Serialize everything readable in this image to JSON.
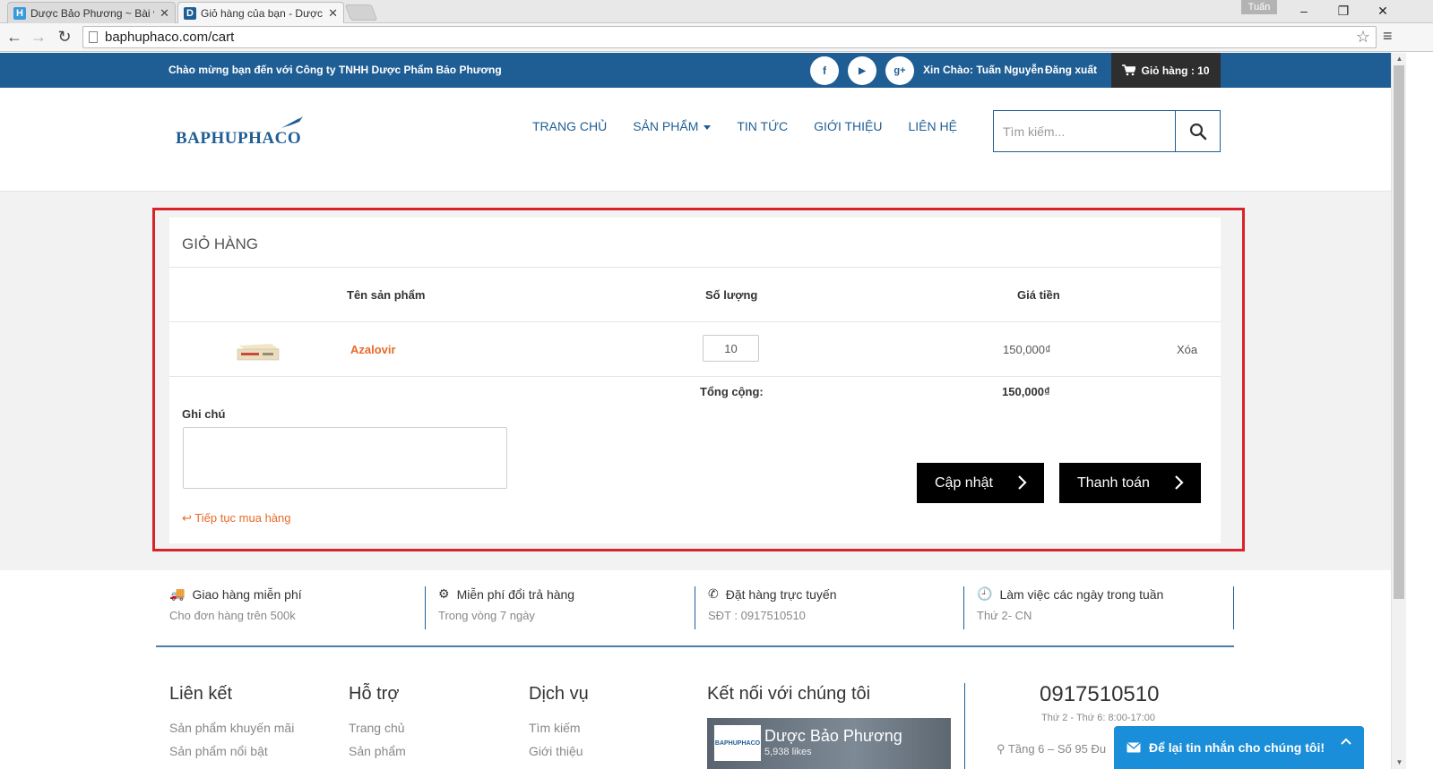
{
  "browser": {
    "tabs": [
      {
        "favicon": "H",
        "favicon_color": "#3a9ad9",
        "title": "Dược Bảo Phương ~ Bài vi",
        "active": false
      },
      {
        "favicon": "D",
        "favicon_color": "#1f5e94",
        "title": "Giỏ hàng của bạn - Dược",
        "active": true
      }
    ],
    "user_badge": "Tuấn",
    "url": "baphuphaco.com/cart"
  },
  "topbar": {
    "welcome": "Chào mừng bạn đến với Công ty TNHH Dược Phẩm Bảo Phương",
    "social": [
      "f",
      "▶",
      "g+"
    ],
    "greeting": "Xin Chào: Tuấn Nguyễn",
    "logout": "Đăng xuất",
    "cart_label": "Giỏ hàng : 10"
  },
  "header": {
    "logo_text": "BAPHUPHACO",
    "nav": [
      "TRANG CHỦ",
      "SẢN PHẨM",
      "TIN TỨC",
      "GIỚI THIỆU",
      "LIÊN HỆ"
    ],
    "search_placeholder": "Tìm kiếm..."
  },
  "cart": {
    "title": "GIỎ HÀNG",
    "columns": {
      "name": "Tên sản phẩm",
      "qty": "Số lượng",
      "price": "Giá tiền"
    },
    "items": [
      {
        "name": "Azalovir",
        "qty": "10",
        "price": "150,000₫",
        "delete": "Xóa"
      }
    ],
    "total_label": "Tổng cộng:",
    "total_value": "150,000₫",
    "note_label": "Ghi chú",
    "continue_link": "Tiếp tục mua hàng",
    "update_button": "Cập nhật",
    "checkout_button": "Thanh toán"
  },
  "features": [
    {
      "icon": "truck-icon",
      "title": "Giao hàng miễn phí",
      "subtitle": "Cho đơn hàng trên 500k"
    },
    {
      "icon": "gear-icon",
      "title": "Miễn phí đổi trả hàng",
      "subtitle": "Trong vòng 7 ngày"
    },
    {
      "icon": "phone-icon",
      "title": "Đặt hàng trực tuyến",
      "subtitle": "SĐT : 0917510510"
    },
    {
      "icon": "clock-icon",
      "title": "Làm việc các ngày trong tuần",
      "subtitle": "Thứ 2- CN"
    }
  ],
  "footer": {
    "col1": {
      "title": "Liên kết",
      "links": [
        "Sản phẩm khuyến mãi",
        "Sản phẩm nổi bật"
      ]
    },
    "col2": {
      "title": "Hỗ trợ",
      "links": [
        "Trang chủ",
        "Sản phẩm"
      ]
    },
    "col3": {
      "title": "Dịch vụ",
      "links": [
        "Tìm kiếm",
        "Giới thiệu"
      ]
    },
    "col4": {
      "title": "Kết nối với chúng tôi",
      "fb_name": "Dược Bảo Phương",
      "fb_likes": "5,938 likes",
      "fb_logo": "BAPHUPHACO"
    },
    "phone": "0917510510",
    "hours": "Thứ 2 - Thứ 6: 8:00-17:00",
    "address": "Tầng 6 – Số 95 Đu"
  },
  "chat": {
    "label": "Để lại tin nhắn cho chúng tôi!"
  },
  "colors": {
    "brand": "#1f5e94",
    "accent": "#e86a28",
    "highlight": "#d8232a",
    "chat": "#1a8ed8"
  }
}
